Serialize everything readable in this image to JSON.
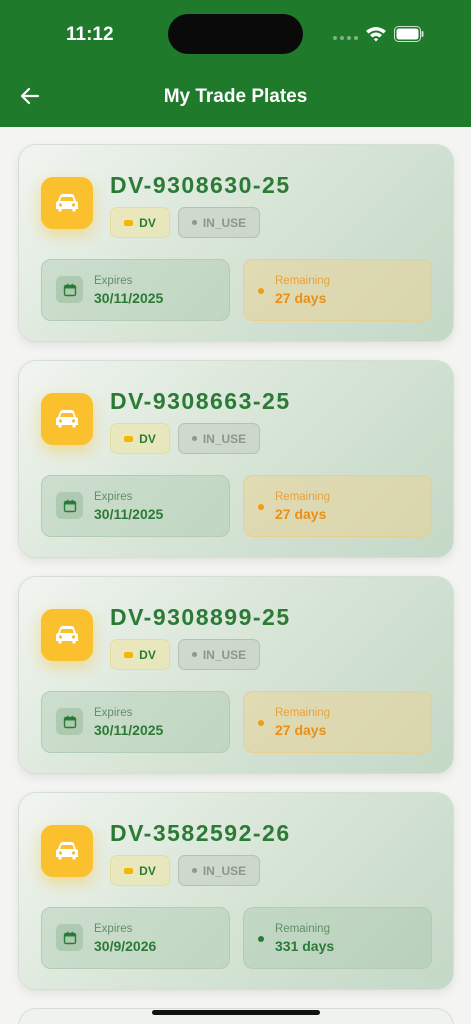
{
  "status_bar": {
    "time": "11:12"
  },
  "header": {
    "title": "My Trade Plates"
  },
  "icons": {
    "back": "arrow-left-icon",
    "vehicle": "car-icon",
    "calendar": "calendar-icon",
    "tag": "tag-icon"
  },
  "colors": {
    "header_bg": "#1f7a2c",
    "accent_green": "#2b7a36",
    "car_tile": "#fbc02d",
    "warning_orange": "#ec8f12"
  },
  "plates": [
    {
      "number": "DV-9308630-25",
      "type": "DV",
      "status": "IN_USE",
      "expires_label": "Expires",
      "expires_date": "30/11/2025",
      "remaining_label": "Remaining",
      "remaining_value": "27 days"
    },
    {
      "number": "DV-9308663-25",
      "type": "DV",
      "status": "IN_USE",
      "expires_label": "Expires",
      "expires_date": "30/11/2025",
      "remaining_label": "Remaining",
      "remaining_value": "27 days"
    },
    {
      "number": "DV-9308899-25",
      "type": "DV",
      "status": "IN_USE",
      "expires_label": "Expires",
      "expires_date": "30/11/2025",
      "remaining_label": "Remaining",
      "remaining_value": "27 days"
    },
    {
      "number": "DV-3582592-26",
      "type": "DV",
      "status": "IN_USE",
      "expires_label": "Expires",
      "expires_date": "30/9/2026",
      "remaining_label": "Remaining",
      "remaining_value": "331 days"
    }
  ]
}
